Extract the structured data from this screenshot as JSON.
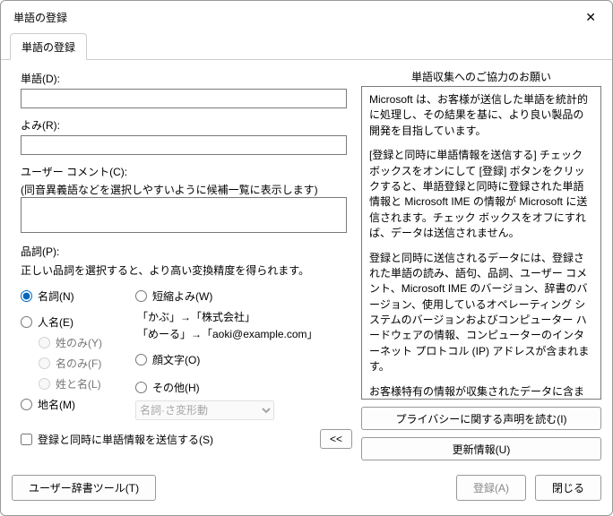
{
  "window": {
    "title": "単語の登録"
  },
  "tabs": {
    "main": "単語の登録"
  },
  "fields": {
    "word_label": "単語(D):",
    "reading_label": "よみ(R):",
    "comment_label": "ユーザー コメント(C):",
    "comment_hint": "(同音異義語などを選択しやすいように候補一覧に表示します)"
  },
  "pos": {
    "label": "品詞(P):",
    "hint": "正しい品詞を選択すると、より高い変換精度を得られます。",
    "noun": "名詞(N)",
    "person": "人名(E)",
    "surname_only": "姓のみ(Y)",
    "given_only": "名のみ(F)",
    "surname_given": "姓と名(L)",
    "place": "地名(M)",
    "short_reading": "短縮よみ(W)",
    "example1": "「かぶ」→「株式会社」",
    "example2": "「めーる」→「aoki@example.com」",
    "face": "顔文字(O)",
    "other": "その他(H)",
    "select_default": "名詞·さ変形動"
  },
  "bottom": {
    "send_check": "登録と同時に単語情報を送信する(S)",
    "collapse": "<<"
  },
  "right": {
    "title": "単語収集へのご協力のお願い",
    "p1": "Microsoft は、お客様が送信した単語を統計的に処理し、その結果を基に、より良い製品の開発を目指しています。",
    "p2": "[登録と同時に単語情報を送信する] チェック ボックスをオンにして [登録] ボタンをクリックすると、単語登録と同時に登録された単語情報と Microsoft IME の情報が Microsoft に送信されます。チェック ボックスをオフにすれば、データは送信されません。",
    "p3": "登録と同時に送信されるデータには、登録された単語の読み、語句、品詞、ユーザー コメント、Microsoft IME のバージョン、辞書のバージョン、使用しているオペレーティング システムのバージョンおよびコンピューター ハードウェアの情報、コンピューターのインターネット プロトコル (IP) アドレスが含まれます。",
    "p4": "お客様特有の情報が収集されたデータに含まれることがあります。このような情報が存在する場合でも、Microsoft では、お客様を特定するために使用することはいたしません",
    "privacy_btn": "プライバシーに関する声明を読む(I)",
    "update_btn": "更新情報(U)"
  },
  "footer": {
    "user_dict": "ユーザー辞書ツール(T)",
    "register": "登録(A)",
    "close": "閉じる"
  }
}
